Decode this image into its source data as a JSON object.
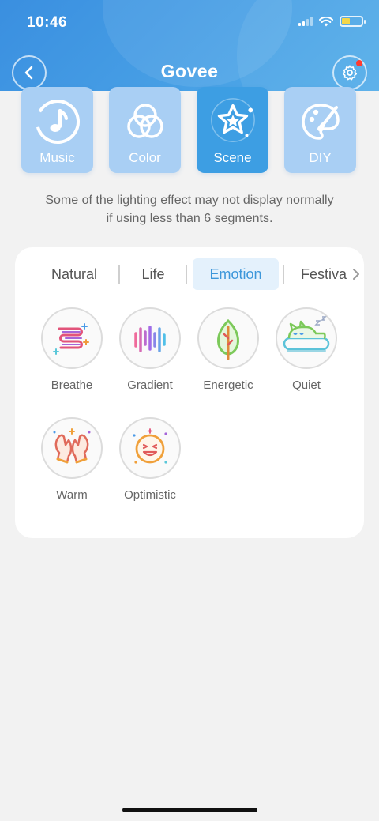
{
  "status_bar": {
    "time": "10:46"
  },
  "header": {
    "brand": "Govee"
  },
  "modes": [
    {
      "label": "Music",
      "icon": "music-note-icon",
      "active": false
    },
    {
      "label": "Color",
      "icon": "color-circles-icon",
      "active": false
    },
    {
      "label": "Scene",
      "icon": "star-scene-icon",
      "active": true
    },
    {
      "label": "DIY",
      "icon": "palette-brush-icon",
      "active": false
    }
  ],
  "notice": {
    "line1": "Some of the lighting effect may not display normally",
    "line2": "if using less than 6 segments."
  },
  "tabs": [
    {
      "label": "Natural",
      "active": false
    },
    {
      "label": "Life",
      "active": false
    },
    {
      "label": "Emotion",
      "active": true
    },
    {
      "label": "Festiva",
      "active": false
    }
  ],
  "scenes": [
    {
      "label": "Breathe",
      "icon": "breathe-icon"
    },
    {
      "label": "Gradient",
      "icon": "gradient-icon"
    },
    {
      "label": "Energetic",
      "icon": "leaf-icon"
    },
    {
      "label": "Quiet",
      "icon": "sleeping-cat-icon"
    },
    {
      "label": "Warm",
      "icon": "mittens-icon"
    },
    {
      "label": "Optimistic",
      "icon": "smiley-icon"
    }
  ],
  "colors": {
    "accent": "#3d9ee3",
    "header": "#3a8fe0",
    "card_inactive": "#a9cff4"
  }
}
